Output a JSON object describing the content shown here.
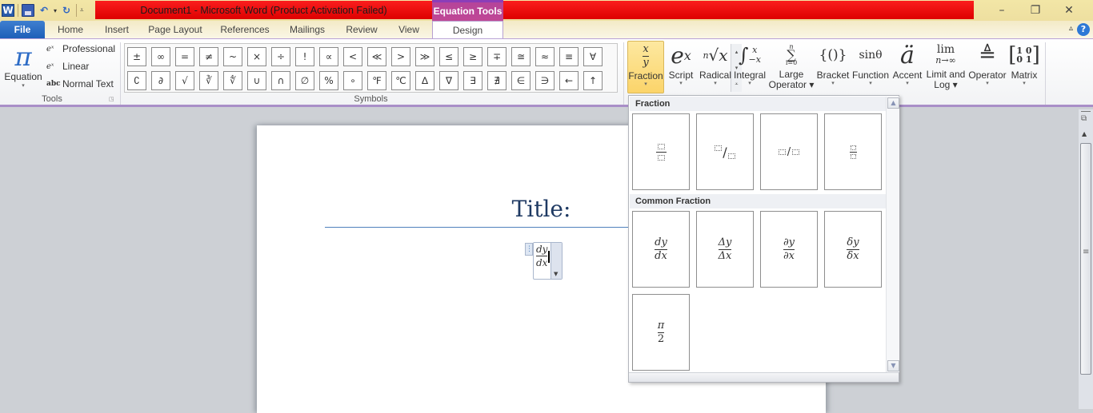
{
  "window": {
    "title": "Document1  -  Microsoft Word (Product Activation Failed)",
    "context_tab_group": "Equation Tools",
    "controls": {
      "minimize": "–",
      "restore": "❐",
      "close": "✕"
    }
  },
  "quick_access": {
    "icons": [
      "word-logo",
      "save-icon",
      "undo-icon",
      "redo-icon",
      "customize-icon"
    ],
    "word_logo": "W",
    "undo": "↶",
    "redo": "↻",
    "dropdown": "▾",
    "customize": "⩡"
  },
  "tabs": [
    {
      "label": "File"
    },
    {
      "label": "Home"
    },
    {
      "label": "Insert"
    },
    {
      "label": "Page Layout"
    },
    {
      "label": "References"
    },
    {
      "label": "Mailings"
    },
    {
      "label": "Review"
    },
    {
      "label": "View"
    },
    {
      "label": "Design",
      "active": true
    }
  ],
  "help": {
    "label": "?",
    "minimize_ribbon": "▵"
  },
  "ribbon": {
    "tools": {
      "group_label": "Tools",
      "equation_glyph": "π",
      "equation_label": "Equation",
      "professional": "Professional",
      "linear": "Linear",
      "normal_text": "Normal Text",
      "normal_text_icon": "abc",
      "eq_icon": "eˣ"
    },
    "symbols": {
      "group_label": "Symbols",
      "row1": [
        "±",
        "∞",
        "=",
        "≠",
        "~",
        "×",
        "÷",
        "!",
        "∝",
        "<",
        "≪",
        ">",
        "≫",
        "≤",
        "≥",
        "∓",
        "≅",
        "≈",
        "≡",
        "∀"
      ],
      "row2": [
        "∁",
        "∂",
        "√",
        "∛",
        "∜",
        "∪",
        "∩",
        "∅",
        "%",
        "∘",
        "℉",
        "℃",
        "∆",
        "∇",
        "∃",
        "∄",
        "∈",
        "∋",
        "←",
        "↑"
      ],
      "scroll_up": "▴",
      "scroll_down": "▾",
      "more": "⩡"
    },
    "structures": [
      {
        "label": "Fraction",
        "glyph": "x/y",
        "active": true
      },
      {
        "label": "Script",
        "glyph": "eˣ"
      },
      {
        "label": "Radical",
        "glyph": "ⁿ√x"
      },
      {
        "label": "Integral",
        "glyph": "∫"
      },
      {
        "label": "Large Operator",
        "line1": "Large",
        "line2": "Operator",
        "glyph": "∑"
      },
      {
        "label": "Bracket",
        "glyph": "{()}"
      },
      {
        "label": "Function",
        "glyph": "sinθ"
      },
      {
        "label": "Accent",
        "glyph": "ä"
      },
      {
        "label": "Limit and Log",
        "line1": "Limit and",
        "line2": "Log",
        "glyph": "lim"
      },
      {
        "label": "Operator",
        "glyph": "≜"
      },
      {
        "label": "Matrix",
        "glyph": "[10 01]"
      }
    ]
  },
  "document": {
    "title": "Title:",
    "equation": {
      "numerator": "dy",
      "denominator": "dx"
    }
  },
  "fraction_gallery": {
    "section1": "Fraction",
    "section1_items": [
      "Stacked Fraction",
      "Skewed Fraction",
      "Linear Fraction",
      "Small Fraction"
    ],
    "section2": "Common Fraction",
    "section2_items": [
      {
        "num": "dy",
        "den": "dx"
      },
      {
        "num": "Δy",
        "den": "Δx"
      },
      {
        "num": "∂y",
        "den": "∂x"
      },
      {
        "num": "δy",
        "den": "δx"
      },
      {
        "num": "π",
        "den": "2"
      }
    ],
    "scroll_up": "▲",
    "scroll_down": "▼"
  }
}
